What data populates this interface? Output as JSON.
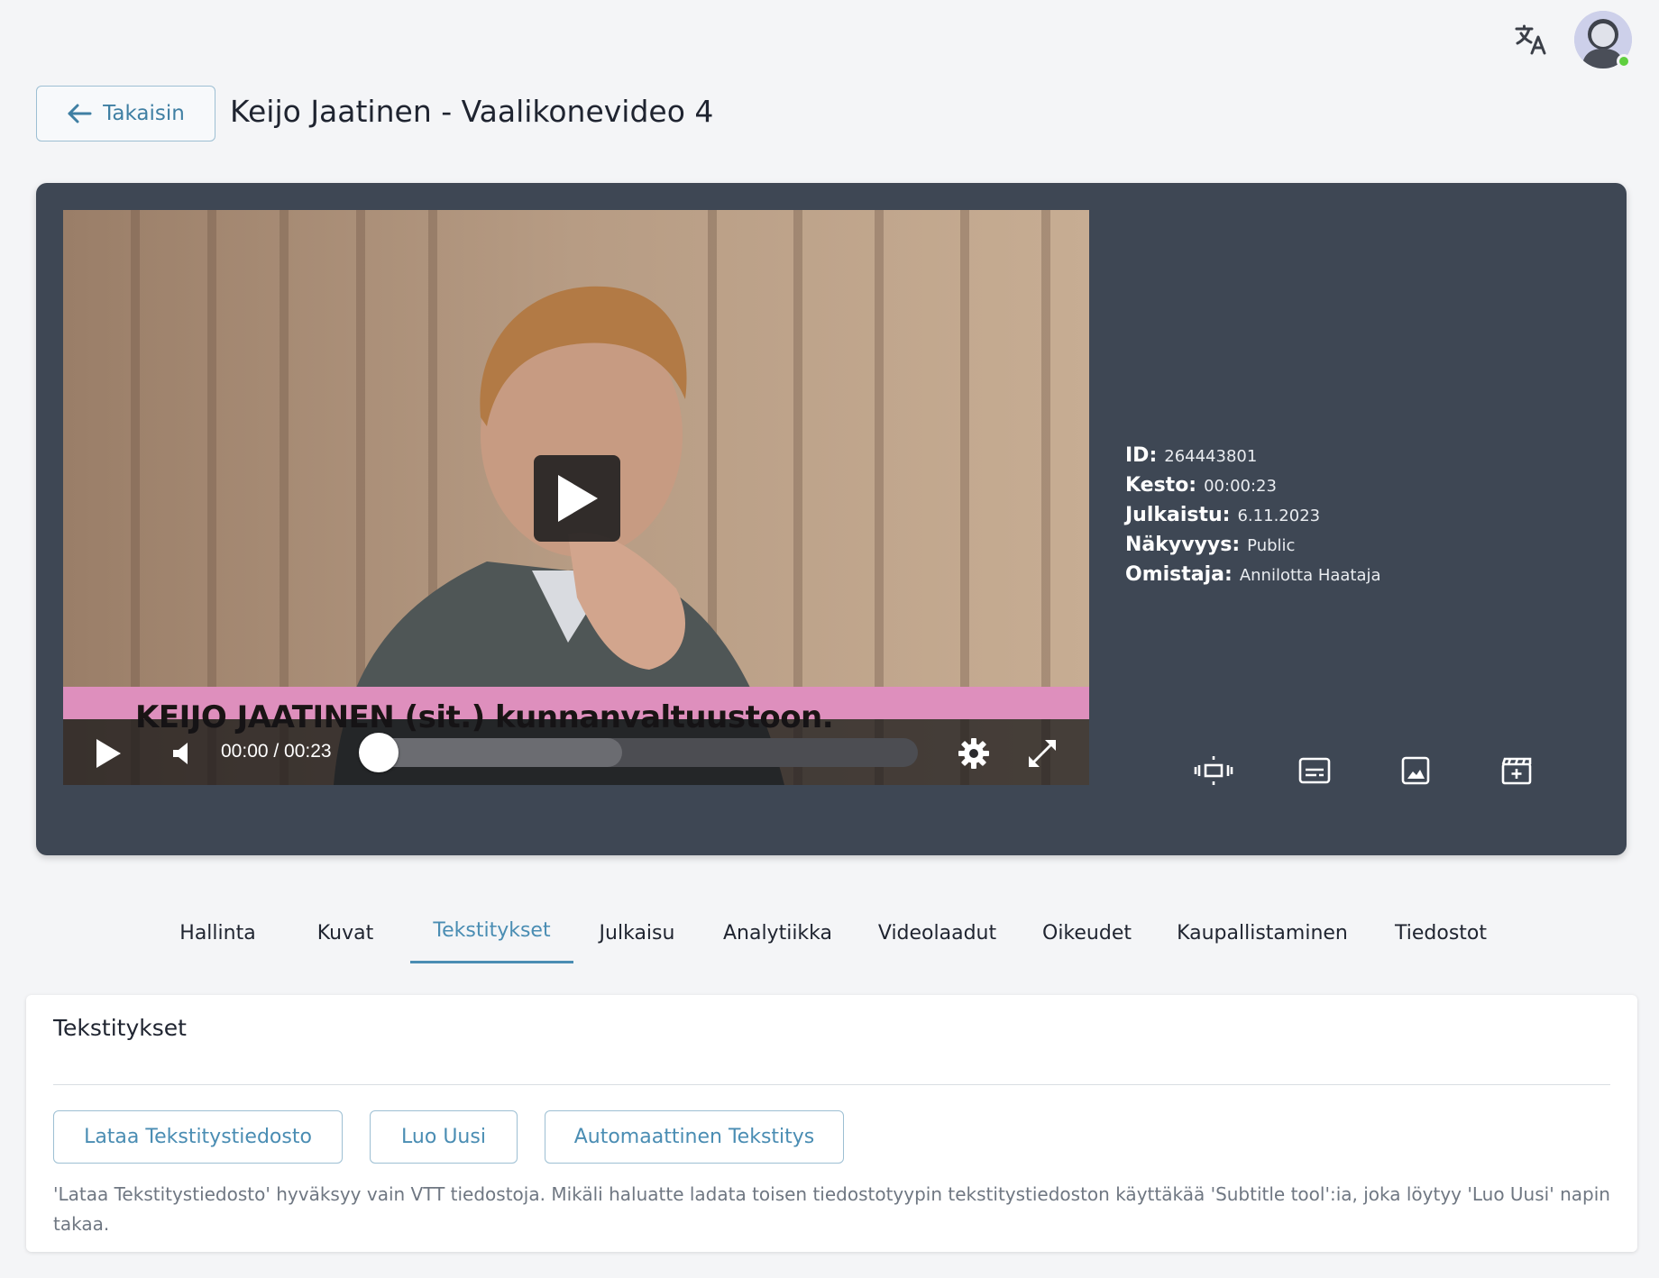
{
  "header": {
    "back_label": "Takaisin",
    "title": "Keijo Jaatinen - Vaalikonevideo 4"
  },
  "topbar": {
    "translate_icon": "translate-icon",
    "avatar_icon": "user-avatar-icon",
    "status_color": "#5fcf3f"
  },
  "player": {
    "caption": "KEIJO JAATINEN (sit.) kunnanvaltuustoon.",
    "time": "00:00 / 00:23",
    "progress": 0,
    "buffered": 0.46,
    "icons": [
      "play-icon",
      "volume-icon",
      "settings-gear-icon",
      "fullscreen-icon"
    ],
    "caption_band_color": "#de8fbd"
  },
  "meta": [
    {
      "key": "ID:",
      "value": "264443801"
    },
    {
      "key": "Kesto:",
      "value": "00:00:23"
    },
    {
      "key": "Julkaistu:",
      "value": "6.11.2023"
    },
    {
      "key": "Näkyvyys:",
      "value": "Public"
    },
    {
      "key": "Omistaja:",
      "value": "Annilotta Haataja"
    }
  ],
  "tools": [
    "trim-icon",
    "subtitles-icon",
    "image-icon",
    "clapperboard-icon"
  ],
  "tabs": [
    {
      "label": "Hallinta"
    },
    {
      "label": "Kuvat"
    },
    {
      "label": "Tekstitykset",
      "active": true
    },
    {
      "label": "Julkaisu"
    },
    {
      "label": "Analytiikka"
    },
    {
      "label": "Videolaadut"
    },
    {
      "label": "Oikeudet"
    },
    {
      "label": "Kaupallistaminen"
    },
    {
      "label": "Tiedostot"
    }
  ],
  "card": {
    "title": "Tekstitykset",
    "buttons": [
      "Lataa Tekstitystiedosto",
      "Luo Uusi",
      "Automaattinen Tekstitys"
    ],
    "note": "'Lataa Tekstitystiedosto' hyväksyy vain VTT tiedostoja. Mikäli haluatte ladata toisen tiedostotyypin tekstitystiedoston käyttäkää 'Subtitle tool':ia, joka löytyy 'Luo Uusi' napin takaa."
  },
  "colors": {
    "accent": "#4a8db3",
    "panel": "#3e4754",
    "background": "#f4f5f7"
  }
}
